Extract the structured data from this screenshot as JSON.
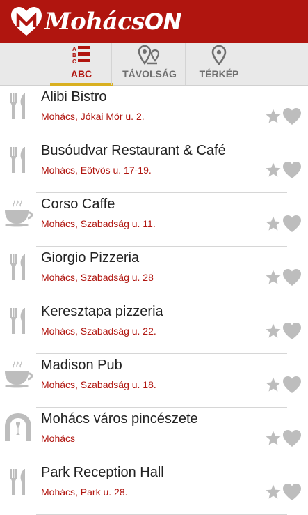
{
  "app": {
    "title_main": "Mohács",
    "title_suffix": "ON"
  },
  "tabs": [
    {
      "label": "ABC",
      "icon": "abc-list-icon",
      "active": true
    },
    {
      "label": "TÁVOLSÁG",
      "icon": "distance-pin-icon",
      "active": false
    },
    {
      "label": "TÉRKÉP",
      "icon": "map-pin-icon",
      "active": false
    }
  ],
  "items": [
    {
      "name": "Alibi Bistro",
      "address": "Mohács, Jókai Mór u. 2.",
      "icon": "fork-knife-icon"
    },
    {
      "name": "Busóudvar Restaurant & Café",
      "address": "Mohács, Eötvös u. 17-19.",
      "icon": "fork-knife-icon"
    },
    {
      "name": "Corso Caffe",
      "address": "Mohács, Szabadság u. 11.",
      "icon": "coffee-cup-icon"
    },
    {
      "name": "Giorgio Pizzeria",
      "address": "Mohács, Szabadság u. 28",
      "icon": "fork-knife-icon"
    },
    {
      "name": "Keresztapa pizzeria",
      "address": "Mohács, Szabadság u. 22.",
      "icon": "fork-knife-icon"
    },
    {
      "name": "Madison Pub",
      "address": "Mohács, Szabadság u. 18.",
      "icon": "coffee-cup-icon"
    },
    {
      "name": "Mohács város pincészete",
      "address": "Mohács",
      "icon": "wine-cellar-icon"
    },
    {
      "name": "Park Reception Hall",
      "address": "Mohács, Park u. 28.",
      "icon": "fork-knife-icon"
    }
  ],
  "colors": {
    "brand": "#b0150f",
    "tab_bg": "#e9e9e9",
    "active_underline": "#d9b020",
    "icon_gray": "#bdbdbd"
  }
}
